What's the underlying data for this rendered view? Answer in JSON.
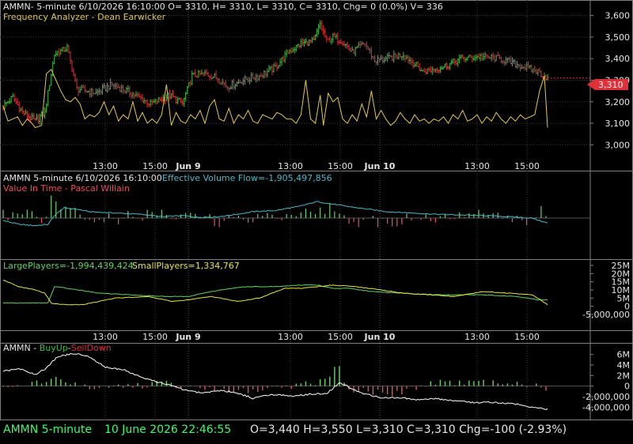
{
  "colors": {
    "background": "#000000",
    "border": "#7f7f7f",
    "grid": "#3a3a3a",
    "up": "#3fbf3f",
    "down": "#e0303a",
    "freq": "#e6c84a",
    "flow": "#49b8c8",
    "vit_up": "#6fd06f",
    "vit_down": "#e85060",
    "large": "#62d262",
    "small": "#e6e640",
    "white": "#ffffff",
    "label": "#e6e6e6",
    "status_green": "#33ff66",
    "status_white": "#e6e6e6"
  },
  "panel1": {
    "header": "AMMN- 5-minute 6/10/2026 16:10:00 O= 3310, H= 3310, L= 3310, C= 3310, Chg= 0 (0.0%) V= 336",
    "indicator": "Frequency Analyzer - Dean Earwicker",
    "price_tag": "3,310"
  },
  "panel2": {
    "header_a": "AMMN 5-minute  6/10/2026 16:10:00",
    "header_b": "Effective Volume Flow=-1,905,497,856",
    "indicator": "Value In Time - Pascal Willain"
  },
  "panel3": {
    "large": "LargePlayers=-1,994,439,424",
    "small": "SmallPlayers=1,334,767"
  },
  "panel4": {
    "prefix": "AMMN - ",
    "buy": "BuyUp",
    "dash": "-",
    "sell": "SellDown"
  },
  "time_axis": {
    "labels": [
      "13:00",
      "15:00",
      "Jun 9",
      "13:00",
      "15:00",
      "Jun 10",
      "13:00",
      "15:00"
    ],
    "bold": [
      false,
      false,
      true,
      false,
      false,
      true,
      false,
      false
    ],
    "dates_label": "Jun 10"
  },
  "status": {
    "symbol": "AMMN  5-minute",
    "date": "10 June 2026 22:46:55",
    "ohlc": "O=3,440  H=3,550  L=3,310  C=3,310  Chg=-100 (-2.93%)"
  },
  "chart_data": [
    {
      "type": "candlestick",
      "title": "AMMN- 5-minute",
      "ylim": [
        2950,
        3650
      ],
      "yticks": [
        3000,
        3100,
        3200,
        3300,
        3400,
        3500,
        3600
      ],
      "ytick_labels": [
        "3,000",
        "3,100",
        "3,200",
        "3,300",
        "3,400",
        "3,500",
        "3,600"
      ],
      "last_price": 3310,
      "close_keypoints": [
        [
          0,
          3180
        ],
        [
          6,
          3220
        ],
        [
          12,
          3150
        ],
        [
          20,
          3110
        ],
        [
          26,
          3150
        ],
        [
          32,
          3420
        ],
        [
          40,
          3450
        ],
        [
          46,
          3260
        ],
        [
          58,
          3240
        ],
        [
          68,
          3280
        ],
        [
          80,
          3240
        ],
        [
          92,
          3190
        ],
        [
          104,
          3230
        ],
        [
          112,
          3190
        ],
        [
          118,
          3320
        ],
        [
          126,
          3330
        ],
        [
          134,
          3310
        ],
        [
          140,
          3270
        ],
        [
          150,
          3300
        ],
        [
          160,
          3320
        ],
        [
          170,
          3360
        ],
        [
          178,
          3430
        ],
        [
          186,
          3470
        ],
        [
          194,
          3480
        ],
        [
          198,
          3560
        ],
        [
          202,
          3480
        ],
        [
          206,
          3500
        ],
        [
          212,
          3480
        ],
        [
          218,
          3430
        ],
        [
          226,
          3470
        ],
        [
          232,
          3390
        ],
        [
          240,
          3400
        ],
        [
          250,
          3420
        ],
        [
          262,
          3340
        ],
        [
          274,
          3360
        ],
        [
          286,
          3400
        ],
        [
          298,
          3410
        ],
        [
          310,
          3400
        ],
        [
          322,
          3370
        ],
        [
          334,
          3340
        ],
        [
          340,
          3310
        ]
      ],
      "freq_keypoints": [
        [
          0,
          3180
        ],
        [
          3,
          3110
        ],
        [
          6,
          3120
        ],
        [
          9,
          3130
        ],
        [
          12,
          3090
        ],
        [
          15,
          3120
        ],
        [
          18,
          3100
        ],
        [
          20,
          3080
        ],
        [
          24,
          3090
        ],
        [
          27,
          3330
        ],
        [
          30,
          3350
        ],
        [
          33,
          3300
        ],
        [
          36,
          3250
        ],
        [
          39,
          3210
        ],
        [
          42,
          3200
        ],
        [
          45,
          3220
        ],
        [
          48,
          3190
        ],
        [
          51,
          3120
        ],
        [
          54,
          3140
        ],
        [
          57,
          3130
        ],
        [
          60,
          3150
        ],
        [
          63,
          3200
        ],
        [
          66,
          3140
        ],
        [
          69,
          3180
        ],
        [
          72,
          3110
        ],
        [
          75,
          3140
        ],
        [
          78,
          3120
        ],
        [
          81,
          3200
        ],
        [
          84,
          3110
        ],
        [
          87,
          3150
        ],
        [
          90,
          3100
        ],
        [
          93,
          3120
        ],
        [
          96,
          3100
        ],
        [
          99,
          3140
        ],
        [
          102,
          3280
        ],
        [
          105,
          3090
        ],
        [
          108,
          3150
        ],
        [
          111,
          3110
        ],
        [
          114,
          3100
        ],
        [
          117,
          3140
        ],
        [
          120,
          3120
        ],
        [
          123,
          3160
        ],
        [
          126,
          3100
        ],
        [
          129,
          3180
        ],
        [
          132,
          3210
        ],
        [
          135,
          3120
        ],
        [
          138,
          3110
        ],
        [
          141,
          3170
        ],
        [
          144,
          3100
        ],
        [
          147,
          3140
        ],
        [
          150,
          3120
        ],
        [
          153,
          3160
        ],
        [
          156,
          3110
        ],
        [
          159,
          3100
        ],
        [
          162,
          3140
        ],
        [
          165,
          3130
        ],
        [
          168,
          3120
        ],
        [
          171,
          3150
        ],
        [
          174,
          3140
        ],
        [
          177,
          3120
        ],
        [
          180,
          3120
        ],
        [
          183,
          3100
        ],
        [
          186,
          3140
        ],
        [
          189,
          3300
        ],
        [
          192,
          3120
        ],
        [
          195,
          3100
        ],
        [
          198,
          3230
        ],
        [
          200,
          3090
        ],
        [
          203,
          3240
        ],
        [
          206,
          3200
        ],
        [
          209,
          3220
        ],
        [
          212,
          3120
        ],
        [
          215,
          3100
        ],
        [
          218,
          3140
        ],
        [
          221,
          3110
        ],
        [
          224,
          3190
        ],
        [
          227,
          3130
        ],
        [
          230,
          3250
        ],
        [
          233,
          3120
        ],
        [
          236,
          3160
        ],
        [
          239,
          3120
        ],
        [
          242,
          3090
        ],
        [
          245,
          3110
        ],
        [
          248,
          3150
        ],
        [
          251,
          3120
        ],
        [
          254,
          3100
        ],
        [
          257,
          3140
        ],
        [
          260,
          3110
        ],
        [
          263,
          3120
        ],
        [
          266,
          3100
        ],
        [
          269,
          3120
        ],
        [
          272,
          3110
        ],
        [
          275,
          3130
        ],
        [
          278,
          3100
        ],
        [
          281,
          3140
        ],
        [
          284,
          3120
        ],
        [
          287,
          3160
        ],
        [
          290,
          3110
        ],
        [
          293,
          3120
        ],
        [
          296,
          3140
        ],
        [
          299,
          3100
        ],
        [
          302,
          3130
        ],
        [
          305,
          3110
        ],
        [
          308,
          3150
        ],
        [
          311,
          3120
        ],
        [
          314,
          3100
        ],
        [
          317,
          3130
        ],
        [
          320,
          3110
        ],
        [
          323,
          3140
        ],
        [
          326,
          3120
        ],
        [
          329,
          3130
        ],
        [
          332,
          3140
        ],
        [
          335,
          3250
        ],
        [
          338,
          3320
        ],
        [
          340,
          3080
        ]
      ]
    },
    {
      "type": "bar+line",
      "title": "Effective Volume Flow / Value In Time",
      "flow_keypoints": [
        [
          0,
          -0.2
        ],
        [
          10,
          -0.5
        ],
        [
          20,
          -0.6
        ],
        [
          28,
          -0.5
        ],
        [
          32,
          0.2
        ],
        [
          38,
          0.8
        ],
        [
          46,
          0.7
        ],
        [
          54,
          0.5
        ],
        [
          70,
          0.4
        ],
        [
          86,
          0.3
        ],
        [
          100,
          0.1
        ],
        [
          112,
          0.2
        ],
        [
          122,
          0.05
        ],
        [
          134,
          0.1
        ],
        [
          146,
          0.3
        ],
        [
          156,
          0.5
        ],
        [
          170,
          0.6
        ],
        [
          184,
          0.9
        ],
        [
          196,
          1.3
        ],
        [
          206,
          1.1
        ],
        [
          216,
          0.9
        ],
        [
          228,
          0.7
        ],
        [
          240,
          0.5
        ],
        [
          256,
          0.4
        ],
        [
          270,
          0.3
        ],
        [
          284,
          0.25
        ],
        [
          300,
          0.2
        ],
        [
          316,
          0.1
        ],
        [
          330,
          0
        ],
        [
          340,
          -0.4
        ]
      ],
      "vit_keypoints": [
        [
          0,
          0.3
        ],
        [
          26,
          0.1
        ],
        [
          30,
          1.5
        ],
        [
          34,
          0.6
        ],
        [
          60,
          -0.2
        ],
        [
          100,
          0.3
        ],
        [
          140,
          -0.3
        ],
        [
          180,
          0.4
        ],
        [
          200,
          0.9
        ],
        [
          220,
          -0.4
        ],
        [
          250,
          -0.2
        ],
        [
          290,
          0.2
        ],
        [
          330,
          -0.1
        ],
        [
          338,
          0.7
        ],
        [
          340,
          -1.4
        ]
      ]
    },
    {
      "type": "line",
      "title": "LargePlayers / SmallPlayers",
      "ylim": [
        -5000000,
        25000000
      ],
      "yticks": [
        -5000000,
        0,
        5000000,
        10000000,
        15000000,
        20000000,
        25000000
      ],
      "ytick_labels": [
        "-5,000,000",
        "0",
        "5M",
        "10M",
        "15M",
        "20M",
        "25M"
      ],
      "large_keypoints": [
        [
          0,
          2
        ],
        [
          28,
          2
        ],
        [
          32,
          12
        ],
        [
          40,
          11
        ],
        [
          60,
          8
        ],
        [
          80,
          7
        ],
        [
          100,
          6
        ],
        [
          116,
          6
        ],
        [
          130,
          9
        ],
        [
          150,
          12
        ],
        [
          170,
          12
        ],
        [
          186,
          13
        ],
        [
          196,
          13
        ],
        [
          206,
          11
        ],
        [
          216,
          11
        ],
        [
          230,
          9
        ],
        [
          250,
          8
        ],
        [
          270,
          7
        ],
        [
          300,
          7
        ],
        [
          320,
          6
        ],
        [
          334,
          4
        ],
        [
          340,
          4
        ]
      ],
      "small_keypoints": [
        [
          0,
          16
        ],
        [
          10,
          12
        ],
        [
          20,
          10
        ],
        [
          26,
          8
        ],
        [
          30,
          2
        ],
        [
          36,
          1
        ],
        [
          50,
          1
        ],
        [
          70,
          5
        ],
        [
          90,
          6
        ],
        [
          106,
          3
        ],
        [
          116,
          4
        ],
        [
          130,
          6
        ],
        [
          146,
          3
        ],
        [
          160,
          5
        ],
        [
          176,
          11
        ],
        [
          186,
          11
        ],
        [
          196,
          12
        ],
        [
          206,
          13
        ],
        [
          220,
          12
        ],
        [
          236,
          10
        ],
        [
          250,
          8
        ],
        [
          266,
          7
        ],
        [
          282,
          6
        ],
        [
          300,
          9
        ],
        [
          316,
          8
        ],
        [
          330,
          7
        ],
        [
          334,
          5
        ],
        [
          340,
          1
        ]
      ]
    },
    {
      "type": "bar+line",
      "title": "AMMN - BuyUp-SellDown",
      "ylim": [
        -5000000,
        7000000
      ],
      "yticks": [
        -4000000,
        -2000000,
        0,
        2000000,
        4000000,
        6000000
      ],
      "ytick_labels": [
        "-4,000,000",
        "-2,000,000",
        "0",
        "2M",
        "4M",
        "6M"
      ],
      "line_keypoints": [
        [
          0,
          2.8
        ],
        [
          10,
          3.4
        ],
        [
          20,
          2.2
        ],
        [
          26,
          3.2
        ],
        [
          34,
          5.6
        ],
        [
          44,
          6.2
        ],
        [
          52,
          5.8
        ],
        [
          64,
          3.6
        ],
        [
          76,
          3
        ],
        [
          86,
          1.7
        ],
        [
          96,
          0.8
        ],
        [
          104,
          0.2
        ],
        [
          114,
          -0.8
        ],
        [
          124,
          -1.3
        ],
        [
          136,
          -0.8
        ],
        [
          146,
          -1.3
        ],
        [
          156,
          -2.3
        ],
        [
          168,
          -1.6
        ],
        [
          180,
          -1.9
        ],
        [
          192,
          -1.6
        ],
        [
          202,
          -1.4
        ],
        [
          210,
          0.6
        ],
        [
          216,
          -0.2
        ],
        [
          224,
          -1.4
        ],
        [
          236,
          -2.2
        ],
        [
          248,
          -2.2
        ],
        [
          258,
          -2.6
        ],
        [
          270,
          -2.4
        ],
        [
          282,
          -2.8
        ],
        [
          294,
          -3.1
        ],
        [
          306,
          -3.1
        ],
        [
          318,
          -3.3
        ],
        [
          330,
          -4
        ],
        [
          340,
          -4.4
        ]
      ],
      "bar_keypoints": [
        [
          0,
          0.3
        ],
        [
          20,
          0.6
        ],
        [
          30,
          1.3
        ],
        [
          36,
          0.8
        ],
        [
          60,
          -0.4
        ],
        [
          100,
          0.4
        ],
        [
          150,
          -1
        ],
        [
          180,
          -0.3
        ],
        [
          200,
          1.2
        ],
        [
          210,
          4.4
        ],
        [
          214,
          -0.6
        ],
        [
          240,
          -1.6
        ],
        [
          270,
          0.6
        ],
        [
          300,
          0.5
        ],
        [
          330,
          0.2
        ],
        [
          340,
          -0.4
        ]
      ]
    }
  ]
}
